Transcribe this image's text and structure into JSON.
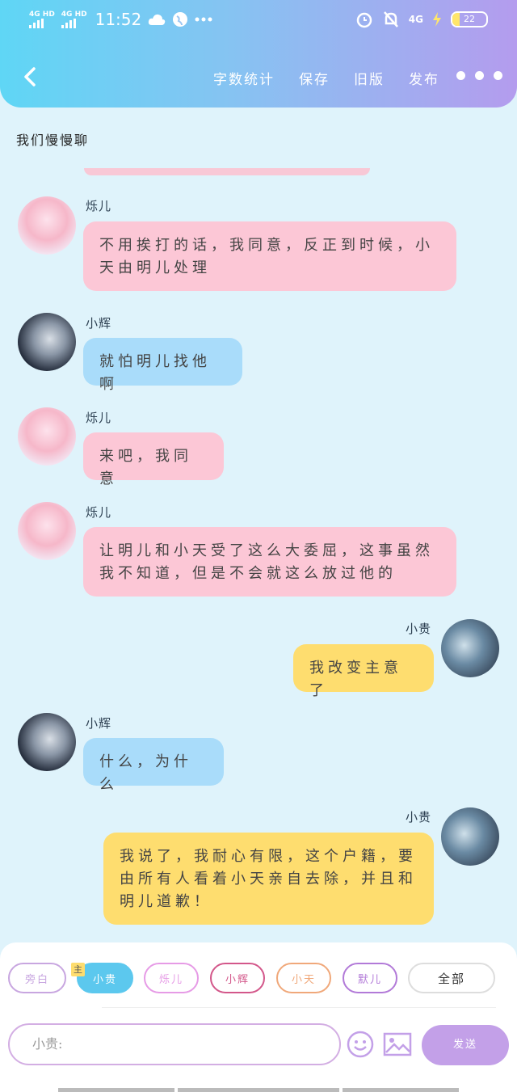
{
  "status": {
    "network1": "4G HD",
    "network2": "4G HD",
    "time": "11:52",
    "network3": "4G",
    "battery": "22"
  },
  "nav": {
    "items": [
      "字数统计",
      "保存",
      "旧版",
      "发布"
    ]
  },
  "chat_title": "我们慢慢聊",
  "messages": [
    {
      "sender": "烁儿",
      "text": "不用挨打的话，我同意，反正到时候，小天由明儿处理"
    },
    {
      "sender": "小辉",
      "text": "就怕明儿找他啊"
    },
    {
      "sender": "烁儿",
      "text": "来吧，我同意"
    },
    {
      "sender": "烁儿",
      "text": "让明儿和小天受了这么大委屈，这事虽然我不知道，但是不会就这么放过他的"
    },
    {
      "sender": "小贵",
      "text": "我改变主意了"
    },
    {
      "sender": "小辉",
      "text": "什么，为什么"
    },
    {
      "sender": "小贵",
      "text": "我说了，我耐心有限，这个户籍，要由所有人看着小天亲自去除，并且和明儿道歉！"
    }
  ],
  "characters": {
    "badge": "主",
    "chips": [
      "旁白",
      "小贵",
      "烁儿",
      "小辉",
      "小天",
      "默儿",
      "全部"
    ]
  },
  "composer": {
    "placeholder": "小贵:",
    "send_label": "发送"
  },
  "colors": {
    "header_start": "#5fd6f5",
    "header_end": "#b49cee",
    "bg": "#dff3fb",
    "pink": "#fcc7d6",
    "blue": "#a9dcfa",
    "yellow": "#fedd6f",
    "send": "#c3a0e8"
  },
  "icons": [
    "back-icon",
    "more-icon",
    "emoji-icon",
    "image-icon",
    "alarm-icon",
    "mute-icon",
    "cloud-icon",
    "globe-icon"
  ]
}
